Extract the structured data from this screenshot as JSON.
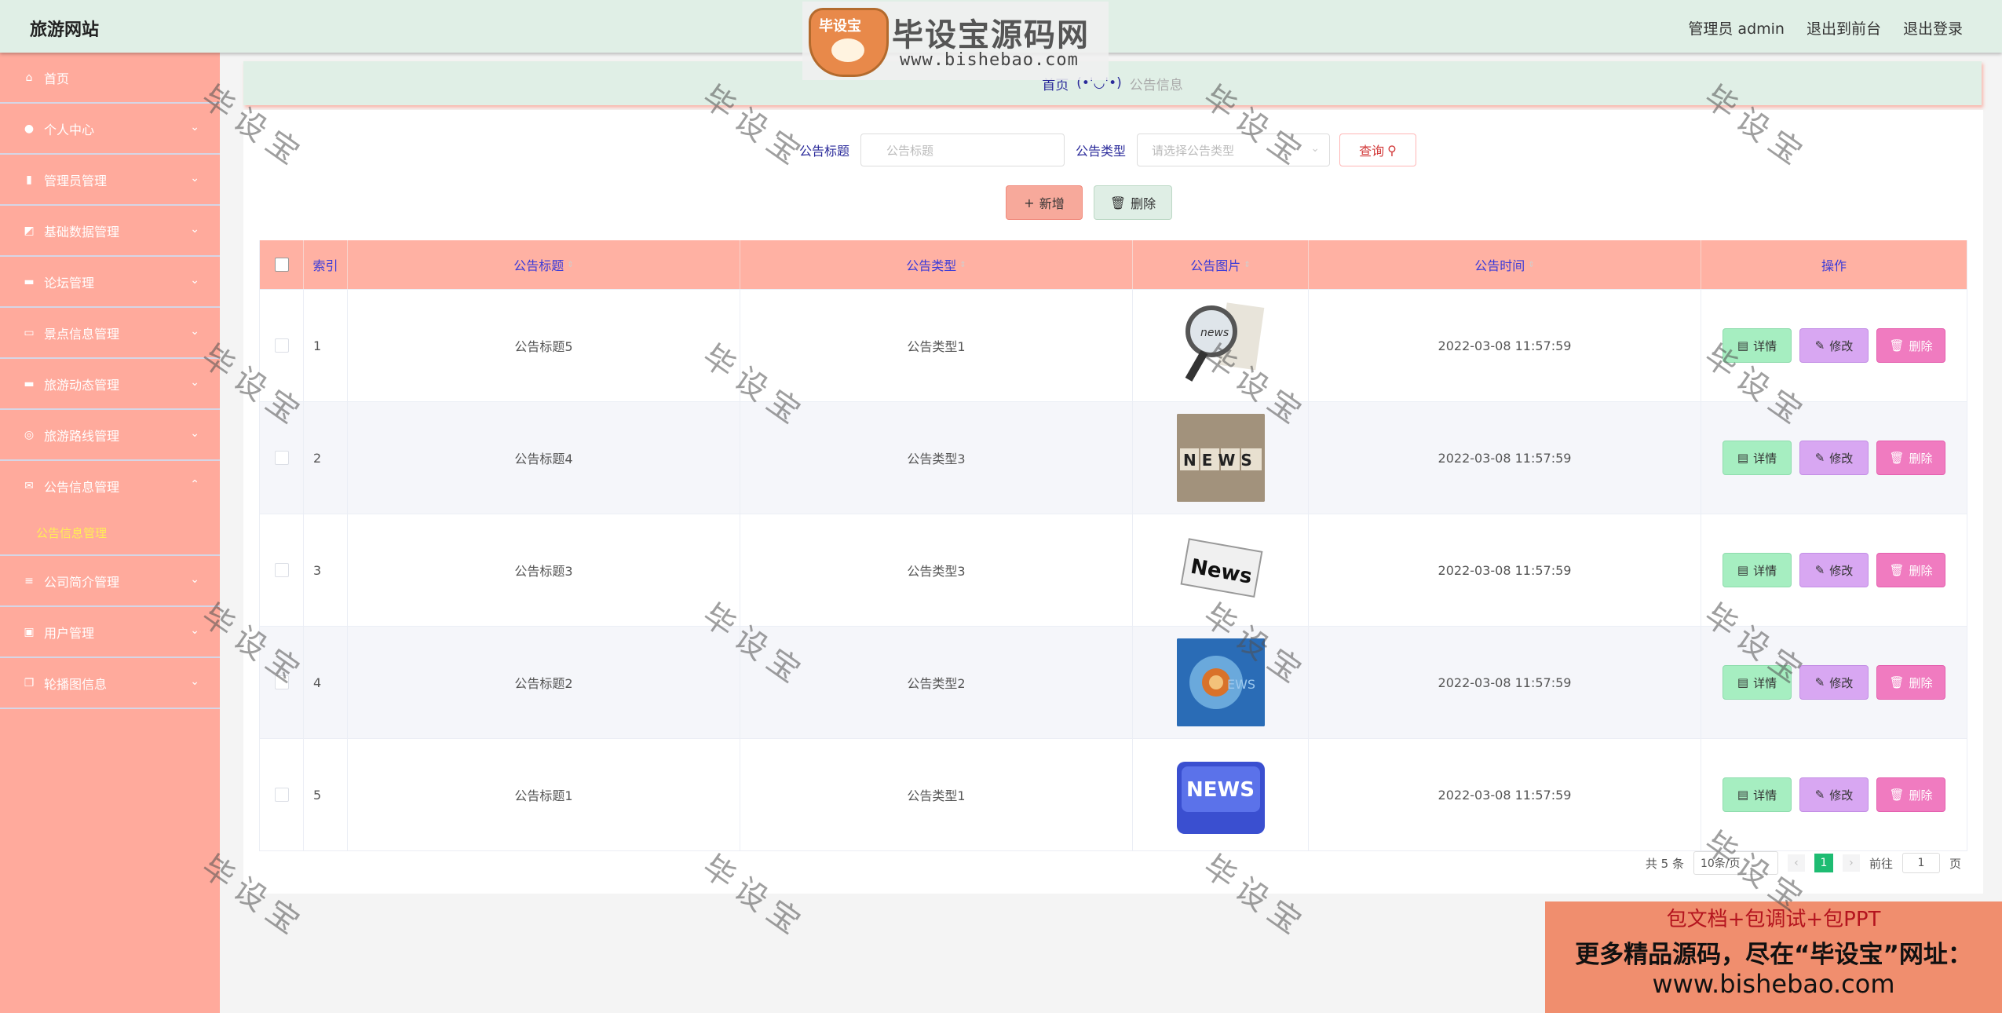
{
  "header": {
    "brand": "旅游网站",
    "user": "管理员 admin",
    "to_front": "退出到前台",
    "logout": "退出登录"
  },
  "watermark": {
    "logo_badge": "毕设宝",
    "logo_title": "毕设宝源码网",
    "logo_url": "www.bishebao.com",
    "repeat_text": "毕设宝",
    "ad_line1": "包文档+包调试+包PPT",
    "ad_line2": "更多精品源码，尽在“毕设宝”网址：",
    "ad_line3": "www.bishebao.com"
  },
  "sidebar": {
    "items": [
      {
        "label": "首页",
        "icon": "home-icon",
        "chevron": ""
      },
      {
        "label": "个人中心",
        "icon": "user-icon",
        "chevron": "⌄"
      },
      {
        "label": "管理员管理",
        "icon": "badge-icon",
        "chevron": "⌄"
      },
      {
        "label": "基础数据管理",
        "icon": "chart-icon",
        "chevron": "⌄"
      },
      {
        "label": "论坛管理",
        "icon": "monitor-icon",
        "chevron": "⌄"
      },
      {
        "label": "景点信息管理",
        "icon": "chat-icon",
        "chevron": "⌄"
      },
      {
        "label": "旅游动态管理",
        "icon": "monitor-icon",
        "chevron": "⌄"
      },
      {
        "label": "旅游路线管理",
        "icon": "compass-icon",
        "chevron": "⌄"
      },
      {
        "label": "公告信息管理",
        "icon": "mail-icon",
        "chevron": "⌃"
      }
    ],
    "sub_active": "公告信息管理",
    "items_after": [
      {
        "label": "公司简介管理",
        "icon": "list-icon",
        "chevron": "⌄"
      },
      {
        "label": "用户管理",
        "icon": "clipboard-icon",
        "chevron": "⌄"
      },
      {
        "label": "轮播图信息",
        "icon": "copy-icon",
        "chevron": "⌄"
      }
    ]
  },
  "breadcrumb": {
    "home": "首页",
    "face": "(•'◡'•)",
    "current": "公告信息"
  },
  "search": {
    "title_label": "公告标题",
    "title_placeholder": "公告标题",
    "type_label": "公告类型",
    "type_placeholder": "请选择公告类型",
    "query_button": "查询"
  },
  "actions": {
    "add": "新增",
    "delete": "删除"
  },
  "table": {
    "headers": [
      "索引",
      "公告标题",
      "公告类型",
      "公告图片",
      "公告时间",
      "操作"
    ],
    "rows": [
      {
        "index": "1",
        "title": "公告标题5",
        "type": "公告类型1",
        "time": "2022-03-08 11:57:59",
        "image": "magnifier-news"
      },
      {
        "index": "2",
        "title": "公告标题4",
        "type": "公告类型3",
        "time": "2022-03-08 11:57:59",
        "image": "news-blocks"
      },
      {
        "index": "3",
        "title": "公告标题3",
        "type": "公告类型3",
        "time": "2022-03-08 11:57:59",
        "image": "newspaper"
      },
      {
        "index": "4",
        "title": "公告标题2",
        "type": "公告类型2",
        "time": "2022-03-08 11:57:59",
        "image": "blue-news"
      },
      {
        "index": "5",
        "title": "公告标题1",
        "type": "公告类型1",
        "time": "2022-03-08 11:57:59",
        "image": "news-key"
      }
    ],
    "op_detail": "详情",
    "op_edit": "修改",
    "op_delete": "删除"
  },
  "pagination": {
    "total": "共 5 条",
    "page_size": "10条/页",
    "current_page": "1",
    "goto_label": "前往",
    "goto_value": "1",
    "page_suffix": "页"
  },
  "colors": {
    "sidebar": "#ffaa9c",
    "header": "#e0efe6",
    "table_header": "#ffb1a3",
    "active_page": "#1ebc72"
  }
}
